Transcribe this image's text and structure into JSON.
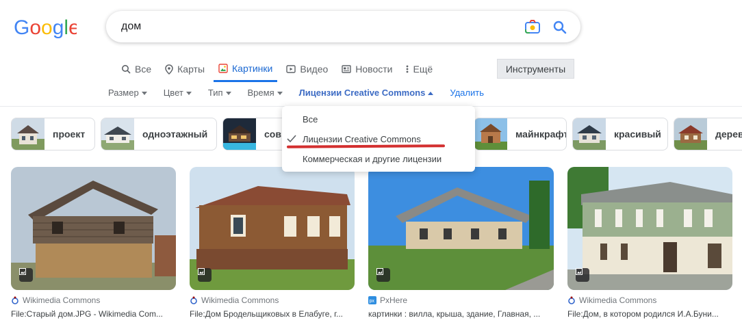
{
  "header": {
    "logo_text": "Google",
    "query": "дом"
  },
  "tabs": [
    {
      "label": "Все",
      "icon": "search-icon",
      "active": false
    },
    {
      "label": "Карты",
      "icon": "map-pin-icon",
      "active": false
    },
    {
      "label": "Картинки",
      "icon": "image-icon",
      "active": true
    },
    {
      "label": "Видео",
      "icon": "video-icon",
      "active": false
    },
    {
      "label": "Новости",
      "icon": "news-icon",
      "active": false
    },
    {
      "label": "Ещё",
      "icon": "more-vert-icon",
      "active": false
    }
  ],
  "tools_label": "Инструменты",
  "filters": {
    "size": "Размер",
    "color": "Цвет",
    "type": "Тип",
    "time": "Время",
    "license": "Лицензии Creative Commons",
    "clear": "Удалить"
  },
  "chips": [
    "проект",
    "одноэтажный",
    "совр",
    "майнкрафт",
    "красивый",
    "дерев"
  ],
  "dropdown": {
    "items": [
      "Все",
      "Лицензии Creative Commons",
      "Коммерческая и другие лицензии"
    ],
    "selected_index": 1
  },
  "results": [
    {
      "source": "Wikimedia Commons",
      "source_icon": "wikimedia-icon",
      "title": "File:Старый дом.JPG - Wikimedia Com..."
    },
    {
      "source": "Wikimedia Commons",
      "source_icon": "wikimedia-icon",
      "title": "File:Дом Бродельщиковых в Елабуге, г..."
    },
    {
      "source": "PxHere",
      "source_icon": "pxhere-icon",
      "title": "картинки : вилла, крыша, здание, Главная, ..."
    },
    {
      "source": "Wikimedia Commons",
      "source_icon": "wikimedia-icon",
      "title": "File:Дом, в котором родился И.А.Буни..."
    }
  ],
  "colors": {
    "accent": "#1a73e8",
    "highlight_underline": "#d32f2f",
    "active_filter": "#3c6bc4"
  }
}
